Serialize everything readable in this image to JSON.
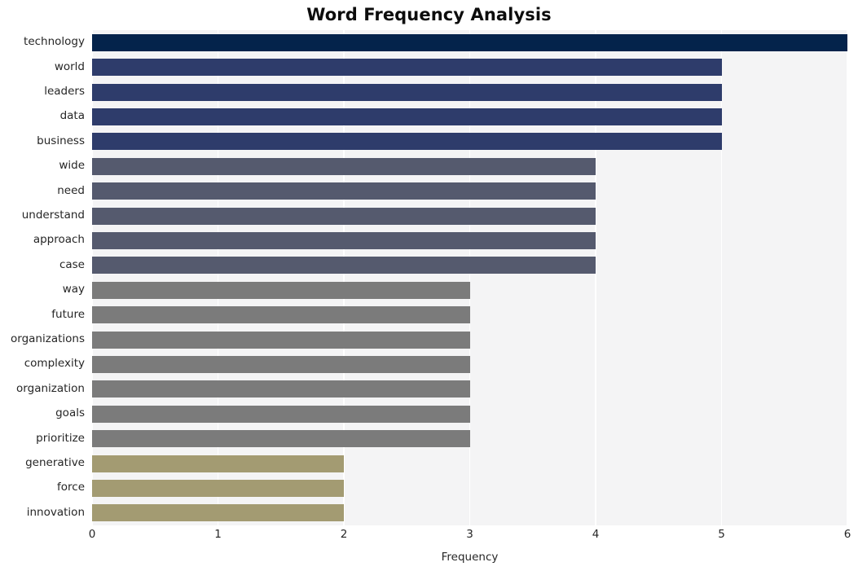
{
  "chart_data": {
    "type": "bar",
    "orientation": "horizontal",
    "title": "Word Frequency Analysis",
    "xlabel": "Frequency",
    "ylabel": "",
    "xlim": [
      0,
      6
    ],
    "xticks": [
      0,
      1,
      2,
      3,
      4,
      5,
      6
    ],
    "xticklabels": [
      "0",
      "1",
      "2",
      "3",
      "4",
      "5",
      "6"
    ],
    "grid": "vertical-white-on-light-gray",
    "legend": "none",
    "categories": [
      "technology",
      "world",
      "leaders",
      "data",
      "business",
      "wide",
      "need",
      "understand",
      "approach",
      "case",
      "way",
      "future",
      "organizations",
      "complexity",
      "organization",
      "goals",
      "prioritize",
      "generative",
      "force",
      "innovation"
    ],
    "values": [
      6,
      5,
      5,
      5,
      5,
      4,
      4,
      4,
      4,
      4,
      3,
      3,
      3,
      3,
      3,
      3,
      3,
      2,
      2,
      2
    ],
    "bar_colors": [
      "#04234b",
      "#2e3c6b",
      "#2e3c6b",
      "#2e3c6b",
      "#2e3c6b",
      "#555a6e",
      "#555a6e",
      "#555a6e",
      "#555a6e",
      "#555a6e",
      "#7b7b7b",
      "#7b7b7b",
      "#7b7b7b",
      "#7b7b7b",
      "#7b7b7b",
      "#7b7b7b",
      "#7b7b7b",
      "#a39b72",
      "#a39b72",
      "#a39b72"
    ]
  },
  "colors": {
    "plot_background": "#f4f4f5",
    "figure_background": "#ffffff",
    "gridline": "#ffffff",
    "tick_text": "#262626",
    "title_text": "#0d0d0d"
  }
}
